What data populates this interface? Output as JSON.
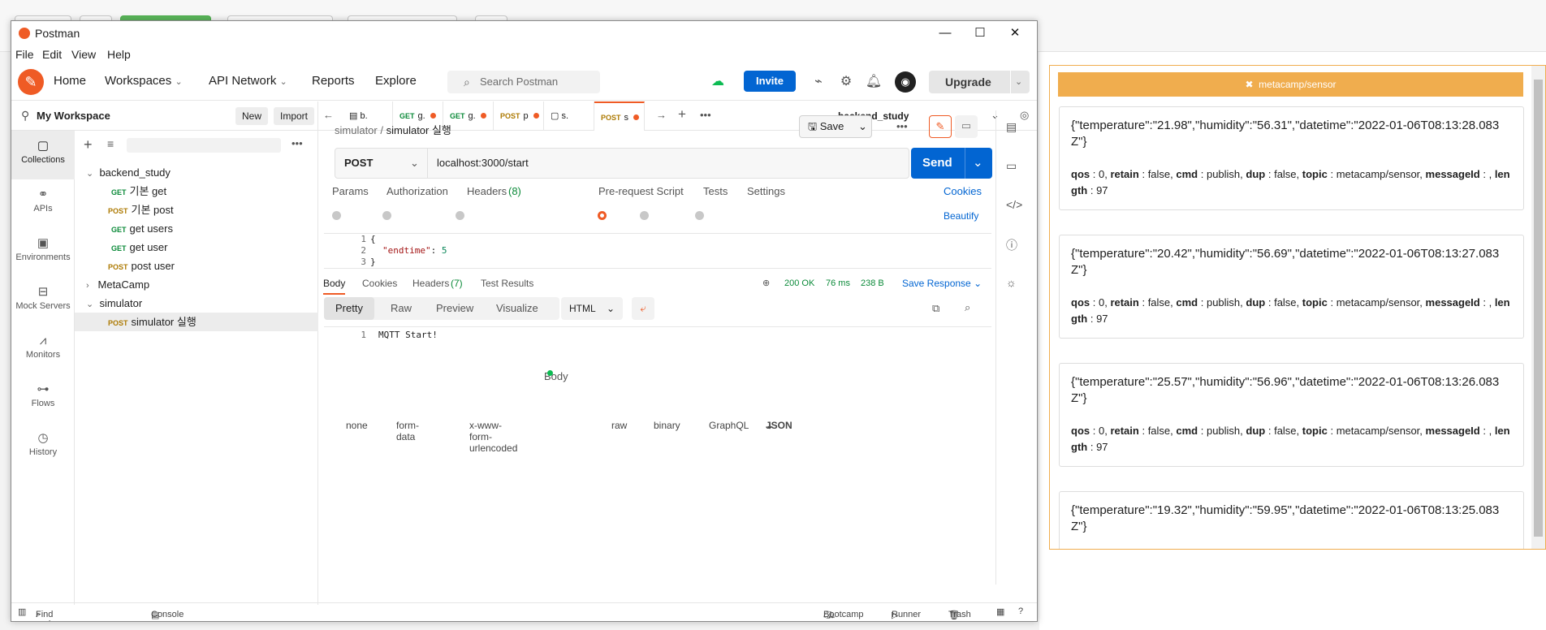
{
  "window": {
    "title": "Postman",
    "minimize": "—",
    "maximize": "☐",
    "close": "✕"
  },
  "menu": [
    "File",
    "Edit",
    "View",
    "Help"
  ],
  "header": {
    "nav": [
      "Home",
      "Workspaces",
      "API Network",
      "Reports",
      "Explore"
    ],
    "search_placeholder": "Search Postman",
    "invite": "Invite",
    "upgrade": "Upgrade"
  },
  "workspace": {
    "name": "My Workspace",
    "new": "New",
    "import": "Import"
  },
  "rail": [
    "Collections",
    "APIs",
    "Environments",
    "Mock Servers",
    "Monitors",
    "Flows",
    "History"
  ],
  "tree": [
    {
      "label": "backend_study",
      "method": "",
      "depth": 0,
      "expanded": true
    },
    {
      "label": "기본 get",
      "method": "GET",
      "depth": 1
    },
    {
      "label": "기본 post",
      "method": "POST",
      "depth": 1
    },
    {
      "label": "get users",
      "method": "GET",
      "depth": 1
    },
    {
      "label": "get user",
      "method": "GET",
      "depth": 1
    },
    {
      "label": "post user",
      "method": "POST",
      "depth": 1
    },
    {
      "label": "MetaCamp",
      "method": "",
      "depth": 0,
      "expanded": false
    },
    {
      "label": "simulator",
      "method": "",
      "depth": 0,
      "expanded": true
    },
    {
      "label": "simulator 실행",
      "method": "POST",
      "depth": 1,
      "selected": true
    }
  ],
  "tabs": [
    {
      "method": "",
      "label": "b."
    },
    {
      "method": "GET",
      "label": "g."
    },
    {
      "method": "GET",
      "label": "g."
    },
    {
      "method": "POST",
      "label": "p"
    },
    {
      "method": "",
      "label": "s."
    },
    {
      "method": "POST",
      "label": "s"
    }
  ],
  "environment": "backend_study",
  "breadcrumb": {
    "parent": "simulator",
    "sep": "/",
    "current": "simulator 실행"
  },
  "save": "Save",
  "request": {
    "method": "POST",
    "url": "localhost:3000/start",
    "send": "Send"
  },
  "request_tabs": [
    "Params",
    "Authorization",
    "Headers",
    "(8)",
    "Body",
    "Pre-request Script",
    "Tests",
    "Settings",
    "Cookies"
  ],
  "body_types": [
    "none",
    "form-data",
    "x-www-form-urlencoded",
    "raw",
    "binary",
    "GraphQL",
    "JSON",
    "Beautify"
  ],
  "body_code": {
    "line1": "{",
    "key": "\"endtime\"",
    "colon": ": ",
    "value": "5",
    "line3": "}"
  },
  "response_tabs": [
    "Body",
    "Cookies",
    "Headers",
    "(7)",
    "Test Results"
  ],
  "response_meta": {
    "status": "200 OK",
    "time": "76 ms",
    "size": "238 B",
    "save": "Save Response"
  },
  "view_modes": [
    "Pretty",
    "Raw",
    "Preview",
    "Visualize"
  ],
  "format": "HTML",
  "response_body": "MQTT Start!",
  "statusbar": {
    "find": "Find and Replace",
    "console": "Console",
    "bootcamp": "Bootcamp",
    "runner": "Runner",
    "trash": "Trash"
  },
  "mqtt": {
    "topic": "metacamp/sensor",
    "messages": [
      {
        "payload": "{\"temperature\":\"21.98\",\"humidity\":\"56.31\",\"datetime\":\"2022-01-06T08:13:28.083Z\"}",
        "qos": "0",
        "retain": "false",
        "cmd": "publish",
        "dup": "false",
        "topic": "metacamp/sensor",
        "messageId": "",
        "length": "97"
      },
      {
        "payload": "{\"temperature\":\"20.42\",\"humidity\":\"56.69\",\"datetime\":\"2022-01-06T08:13:27.083Z\"}",
        "qos": "0",
        "retain": "false",
        "cmd": "publish",
        "dup": "false",
        "topic": "metacamp/sensor",
        "messageId": "",
        "length": "97"
      },
      {
        "payload": "{\"temperature\":\"25.57\",\"humidity\":\"56.96\",\"datetime\":\"2022-01-06T08:13:26.083Z\"}",
        "qos": "0",
        "retain": "false",
        "cmd": "publish",
        "dup": "false",
        "topic": "metacamp/sensor",
        "messageId": "",
        "length": "97"
      },
      {
        "payload": "{\"temperature\":\"19.32\",\"humidity\":\"59.95\",\"datetime\":\"2022-01-06T08:13:25.083Z\"}"
      }
    ]
  },
  "colors": {
    "accent": "#ef5b25",
    "primary": "#0265d2",
    "mqtt_header": "#f0ad4e",
    "get": "#0b8a39",
    "post": "#ad7a03"
  }
}
